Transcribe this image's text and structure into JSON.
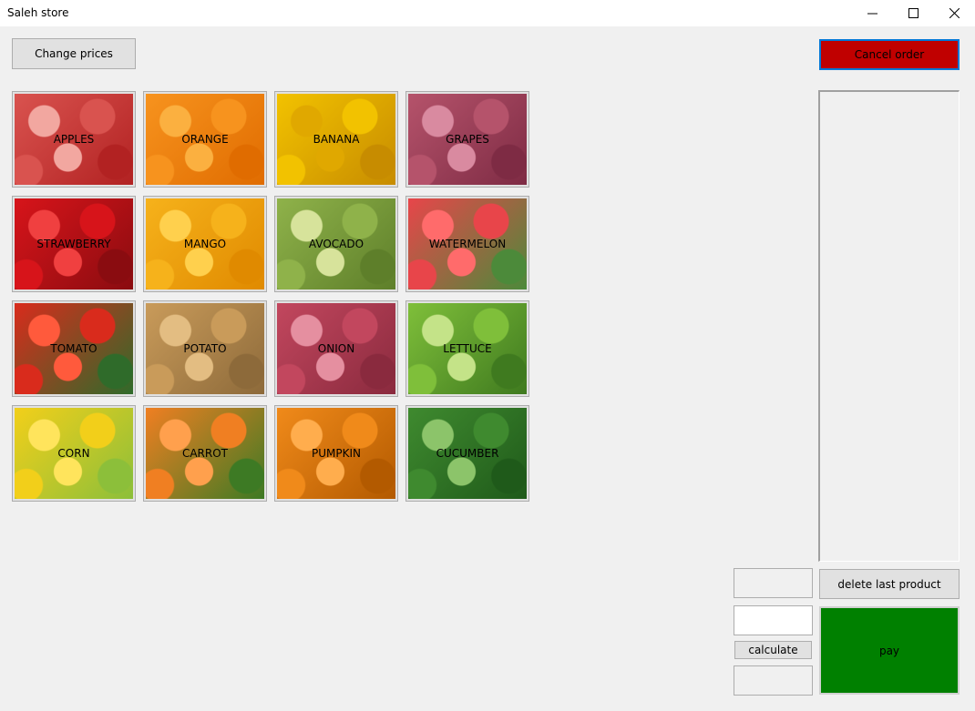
{
  "window": {
    "title": "Saleh store"
  },
  "toolbar": {
    "change_prices": "Change prices",
    "cancel_order": "Cancel order"
  },
  "products": [
    {
      "label": "APPLES",
      "icon": "apples-image",
      "colors": [
        "#d9534f",
        "#f2a7a0",
        "#b22222"
      ]
    },
    {
      "label": "ORANGE",
      "icon": "orange-image",
      "colors": [
        "#f7931e",
        "#fbb040",
        "#e06c00"
      ]
    },
    {
      "label": "BANANA",
      "icon": "banana-image",
      "colors": [
        "#f2c200",
        "#e0a800",
        "#c78c00"
      ]
    },
    {
      "label": "GRAPES",
      "icon": "grapes-image",
      "colors": [
        "#b5536b",
        "#d98aa0",
        "#7e2b44"
      ]
    },
    {
      "label": "STRAWBERRY",
      "icon": "strawberry-image",
      "colors": [
        "#d7141a",
        "#f04040",
        "#8a0c10"
      ]
    },
    {
      "label": "MANGO",
      "icon": "mango-image",
      "colors": [
        "#f6b21b",
        "#ffd04d",
        "#e08a00"
      ]
    },
    {
      "label": "AVOCADO",
      "icon": "avocado-image",
      "colors": [
        "#8fb24a",
        "#d7e39b",
        "#5e7f2a"
      ]
    },
    {
      "label": "WATERMELON",
      "icon": "watermelon-image",
      "colors": [
        "#e8454a",
        "#ff6b6b",
        "#4c8a3a"
      ]
    },
    {
      "label": "TOMATO",
      "icon": "tomato-image",
      "colors": [
        "#d92b1c",
        "#ff5a3c",
        "#2f6b2a"
      ]
    },
    {
      "label": "POTATO",
      "icon": "potato-image",
      "colors": [
        "#c99b5a",
        "#e3bd82",
        "#8d6a3a"
      ]
    },
    {
      "label": "ONION",
      "icon": "onion-image",
      "colors": [
        "#c2475e",
        "#e58fa0",
        "#8a2a3e"
      ]
    },
    {
      "label": "LETTUCE",
      "icon": "lettuce-image",
      "colors": [
        "#7fbf3a",
        "#c4e388",
        "#3f7a1f"
      ]
    },
    {
      "label": "CORN",
      "icon": "corn-image",
      "colors": [
        "#f2cf1a",
        "#ffe45c",
        "#8cbf3a"
      ]
    },
    {
      "label": "CARROT",
      "icon": "carrot-image",
      "colors": [
        "#f07f22",
        "#ffa04d",
        "#3d7a24"
      ]
    },
    {
      "label": "PUMPKIN",
      "icon": "pumpkin-image",
      "colors": [
        "#f08a1a",
        "#ffad4d",
        "#b35a00"
      ]
    },
    {
      "label": "CUCUMBER",
      "icon": "cucumber-image",
      "colors": [
        "#3f8a2f",
        "#8cc46a",
        "#1f5a1a"
      ]
    }
  ],
  "order": {
    "items": []
  },
  "actions": {
    "delete_last": "delete last product",
    "calculate": "calculate",
    "pay": "pay"
  },
  "inputs": {
    "total_value": "",
    "paid_value": "",
    "change_value": ""
  },
  "colors": {
    "cancel_bg": "#c00000",
    "pay_bg": "#008000",
    "focus_border": "#0078d7"
  }
}
